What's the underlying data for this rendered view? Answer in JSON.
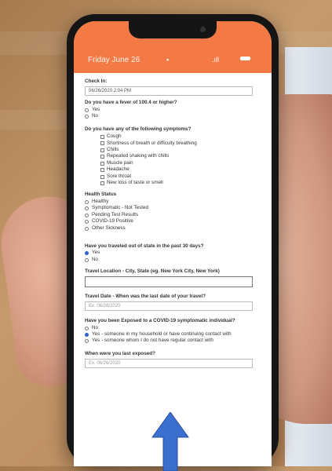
{
  "status_bar": {
    "date": "Friday June 26",
    "wifi_icon": "wifi-icon",
    "signal_text": ".ıll",
    "battery_icon": "battery-icon"
  },
  "colors": {
    "accent": "#f47a45",
    "selected": "#2f5fd0",
    "arrow": "#3a6fd0"
  },
  "form": {
    "checkin": {
      "label": "Check In:",
      "value": "06/26/2020 2:04 PM"
    },
    "fever": {
      "question": "Do you have a fever of 100.4 or higher?",
      "options": [
        "Yes",
        "No"
      ],
      "selected": null
    },
    "symptoms": {
      "question": "Do you have any of the following symptoms?",
      "options": [
        "Cough",
        "Shortness of breath or difficulty breathing",
        "Chills",
        "Repeated shaking with chills",
        "Muscle pain",
        "Headache",
        "Sore throat",
        "New loss of taste or smell"
      ]
    },
    "health_status": {
      "question": "Health Status",
      "options": [
        "Healthy",
        "Symptomatic - Not Tested",
        "Pending Test Results",
        "COVID-19 Positive",
        "Other Sickness"
      ]
    },
    "travel": {
      "question": "Have you traveled out of state in the past 30 days?",
      "options": [
        "Yes",
        "No"
      ],
      "selected": "Yes"
    },
    "travel_location": {
      "label": "Travel Location - City, State (eg. New York City, New York)",
      "placeholder": ""
    },
    "travel_date": {
      "label": "Travel Date - When was the last date of your travel?",
      "placeholder": "Ex. 06/26/2020"
    },
    "exposed": {
      "question": "Have you been Exposed to a COVID-19 symptomatic individual?",
      "options": [
        "No",
        "Yes - someone in my household or have continuing contact with",
        "Yes - someone whom I do not have regular contact with"
      ],
      "selected": "Yes - someone in my household or have continuing contact with"
    },
    "last_exposed": {
      "label": "When were you last exposed?",
      "placeholder": "Ex. 06/26/2020"
    }
  }
}
